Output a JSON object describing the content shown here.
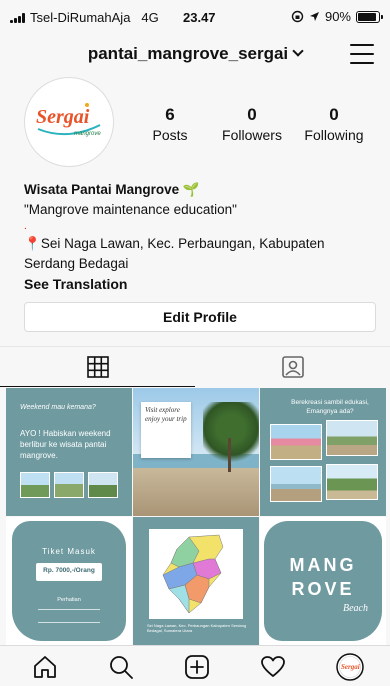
{
  "status_bar": {
    "carrier": "Tsel-DiRumahAja",
    "network": "4G",
    "time": "23.47",
    "battery": "90%",
    "battery_level": 0.9
  },
  "header": {
    "username": "pantai_mangrove_sergai"
  },
  "profile": {
    "avatar_logo": {
      "text": "Sergai",
      "sub": "mangrove"
    },
    "stats": [
      {
        "value": "6",
        "label": "Posts"
      },
      {
        "value": "0",
        "label": "Followers"
      },
      {
        "value": "0",
        "label": "Following"
      }
    ],
    "name": "Wisata Pantai Mangrove 🌱",
    "tagline": "\"Mangrove maintenance education\"",
    "dot": ".",
    "location": "Sei Naga Lawan, Kec. Perbaungan, Kabupaten Serdang Bedagai",
    "see_translation": "See Translation",
    "edit_profile": "Edit Profile"
  },
  "posts": [
    {
      "bg": "#6e9aa0",
      "heading": "Weekend mau kemana?",
      "body": "AYO ! Habiskan weekend berlibur ke wisata pantai mangrove."
    },
    {
      "bg": "#ffffff",
      "script": "Visit explore enjoy your trip"
    },
    {
      "bg": "#6e9aa0",
      "heading": "Berekreasi sambil edukasi, Emangnya ada?"
    },
    {
      "bg": "#6e9aa0",
      "title": "Tiket Masuk",
      "price": "Rp. 7000,-/Orang",
      "subtitle": "Perhatian"
    },
    {
      "bg": "#6e9aa0",
      "caption": "Sei Naga Lawan, Kec. Perbaungan Kabupaten Serdang Bedagai, Sumatera Utara"
    },
    {
      "bg": "#6e9aa0",
      "line1": "MANG",
      "line2": "ROVE",
      "script": "Beach"
    }
  ],
  "colors": {
    "teal": "#6e9aa0",
    "accent_red": "#d00000"
  },
  "nav": {
    "icons": [
      "home-icon",
      "search-icon",
      "add-post-icon",
      "heart-icon",
      "profile-avatar"
    ]
  }
}
